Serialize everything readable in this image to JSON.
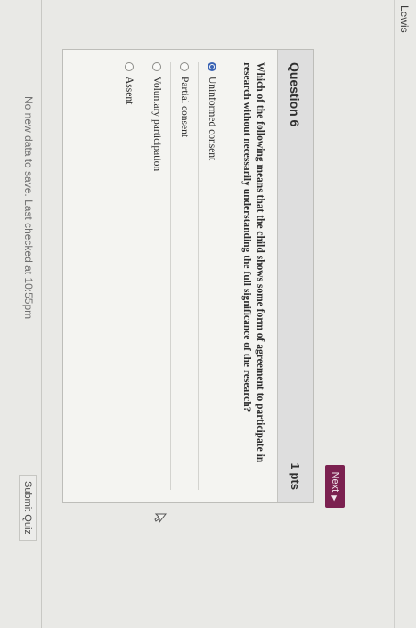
{
  "header": {
    "user_name": "Lewis"
  },
  "question": {
    "title": "Question 6",
    "points": "1 pts",
    "text": "Which of the following means that the child shows some form of agreement to participate in research without necessarily understanding the full significance of the research?",
    "answers": [
      {
        "label": "Uninformed consent",
        "selected": true
      },
      {
        "label": "Partial consent",
        "selected": false
      },
      {
        "label": "Voluntary participation",
        "selected": false
      },
      {
        "label": "Assent",
        "selected": false
      }
    ]
  },
  "nav": {
    "next_label": "Next",
    "next_arrow": "▶"
  },
  "footer": {
    "save_status": "No new data to save. Last checked at 10:55pm",
    "submit_label": "Submit Quiz"
  },
  "colors": {
    "next_button": "#7b2150",
    "radio_selected": "#3a63b4"
  }
}
